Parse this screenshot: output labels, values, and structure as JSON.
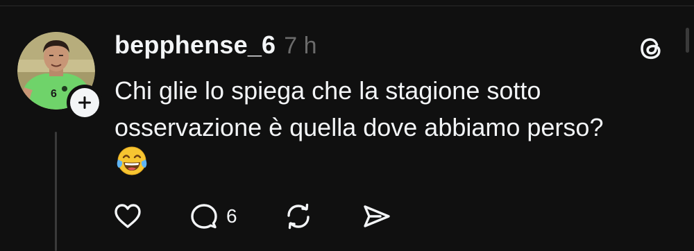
{
  "post": {
    "username": "bepphense_6",
    "timestamp": "7 h",
    "text": "Chi glie lo spiega che la stagione sotto\nosservazione è quella dove  abbiamo perso?",
    "emoji": "face-with-tears-of-joy"
  },
  "actions": {
    "reply_count": "6"
  },
  "icons": {
    "like": "heart-icon",
    "reply": "comment-icon",
    "repost": "repost-icon",
    "share": "send-icon",
    "brand": "threads-logo",
    "follow": "plus-icon"
  },
  "colors": {
    "background": "#101010",
    "text": "#f3f5f7",
    "muted": "#6b6b6b",
    "jersey": "#6fd36a"
  }
}
